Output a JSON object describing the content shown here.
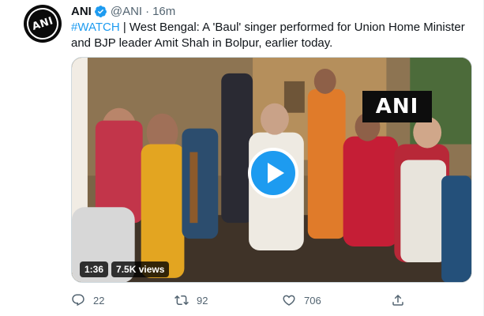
{
  "tweet": {
    "author": {
      "display_name": "ANI",
      "handle": "@ANI",
      "separator": "·",
      "time": "16m",
      "avatar_text": "ANI",
      "verified_icon": "verified-badge-icon"
    },
    "text": {
      "hashtag": "#WATCH",
      "body": " | West Bengal: A 'Baul' singer performed for Union Home Minister and BJP leader Amit Shah in Bolpur, earlier today."
    },
    "media": {
      "watermark": "ANI",
      "duration": "1:36",
      "views": "7.5K views",
      "play_icon": "play-icon"
    },
    "actions": {
      "replies": "22",
      "retweets": "92",
      "likes": "706",
      "reply_icon": "reply-icon",
      "retweet_icon": "retweet-icon",
      "like_icon": "heart-icon",
      "share_icon": "share-icon"
    }
  },
  "colors": {
    "accent": "#1d9bf0",
    "text_primary": "#0f1419",
    "text_secondary": "#536471"
  }
}
